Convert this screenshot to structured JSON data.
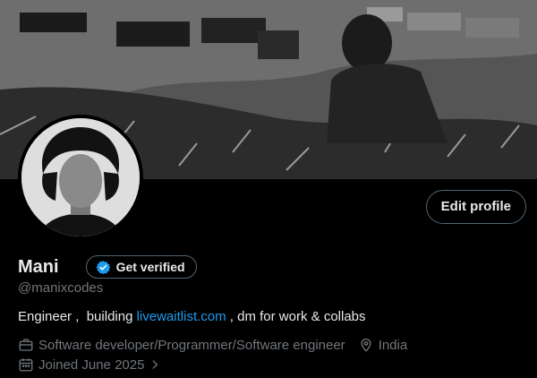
{
  "profile": {
    "name": "Mani",
    "handle": "@manixcodes",
    "verify_label": "Get verified",
    "edit_label": "Edit profile",
    "bio": {
      "prefix": "Engineer ,  building ",
      "link": "livewaitlist.com",
      "suffix": " , dm for work & collabs"
    },
    "profession": "Software developer/Programmer/Software engineer",
    "location": "India",
    "joined": "Joined June 2025"
  },
  "icons": {
    "verify": "verified-badge-icon",
    "profession": "briefcase-icon",
    "location": "location-pin-icon",
    "joined": "calendar-icon",
    "chevron": "chevron-right-icon"
  },
  "colors": {
    "accent": "#1d9bf0",
    "muted": "#71767b",
    "text": "#e7e9ea",
    "border": "#536471"
  }
}
